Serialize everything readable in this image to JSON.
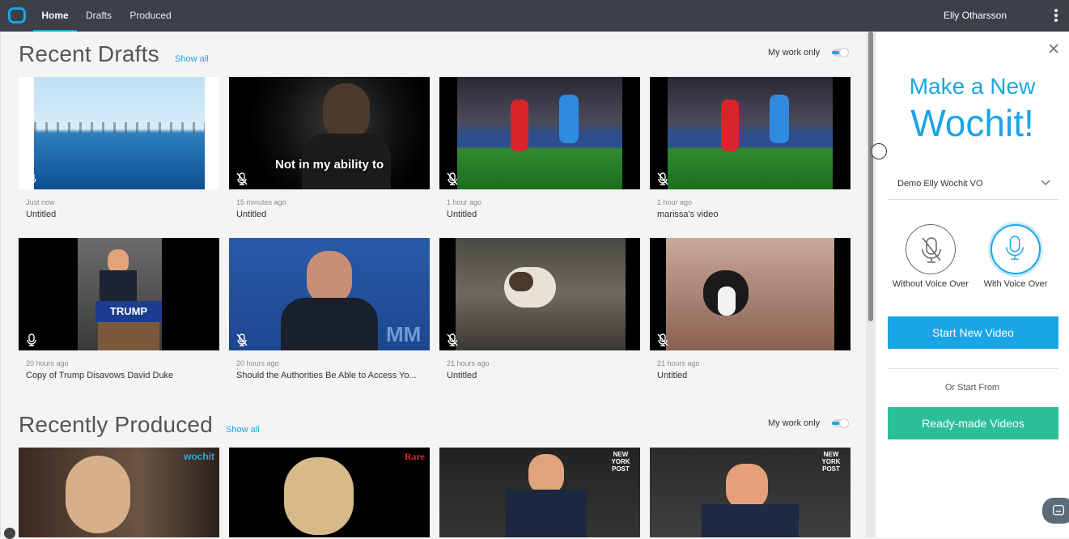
{
  "topbar": {
    "tabs": [
      {
        "label": "Home",
        "active": true
      },
      {
        "label": "Drafts",
        "active": false
      },
      {
        "label": "Produced",
        "active": false
      }
    ],
    "user_name": "Elly Otharsson",
    "accent_color": "#1aa5e6"
  },
  "recent_drafts": {
    "title": "Recent Drafts",
    "show_all": "Show all",
    "my_work_only": "My work only",
    "cards": [
      {
        "time": "Just now",
        "title": "Untitled"
      },
      {
        "time": "15 minutes ago",
        "title": "Untitled",
        "overlay": "Not in my ability to"
      },
      {
        "time": "1 hour ago",
        "title": "Untitled"
      },
      {
        "time": "1 hour ago",
        "title": "marissa's video"
      },
      {
        "time": "20 hours ago",
        "title": "Copy of Trump Disavows David Duke",
        "sign": "TRUMP"
      },
      {
        "time": "20 hours ago",
        "title": "Should the Authorities Be Able to Access Yo..."
      },
      {
        "time": "21 hours ago",
        "title": "Untitled"
      },
      {
        "time": "21 hours ago",
        "title": "Untitled"
      }
    ]
  },
  "recently_produced": {
    "title": "Recently Produced",
    "show_all": "Show all",
    "my_work_only": "My work only",
    "cards": [
      {
        "brand": "wochit"
      },
      {
        "brand": "Rare"
      },
      {
        "brand": "NEW YORK POST"
      },
      {
        "brand": "NEW YORK POST"
      }
    ]
  },
  "panel": {
    "title_line1": "Make a New",
    "title_line2": "Wochit!",
    "voice_select": "Demo Elly Wochit VO",
    "without_vo": "Without Voice Over",
    "with_vo": "With Voice Over",
    "start_new": "Start New Video",
    "or_start_from": "Or Start From",
    "ready_made": "Ready-made Videos",
    "start_color": "#1aa5e6",
    "ready_color": "#2bbf98"
  }
}
